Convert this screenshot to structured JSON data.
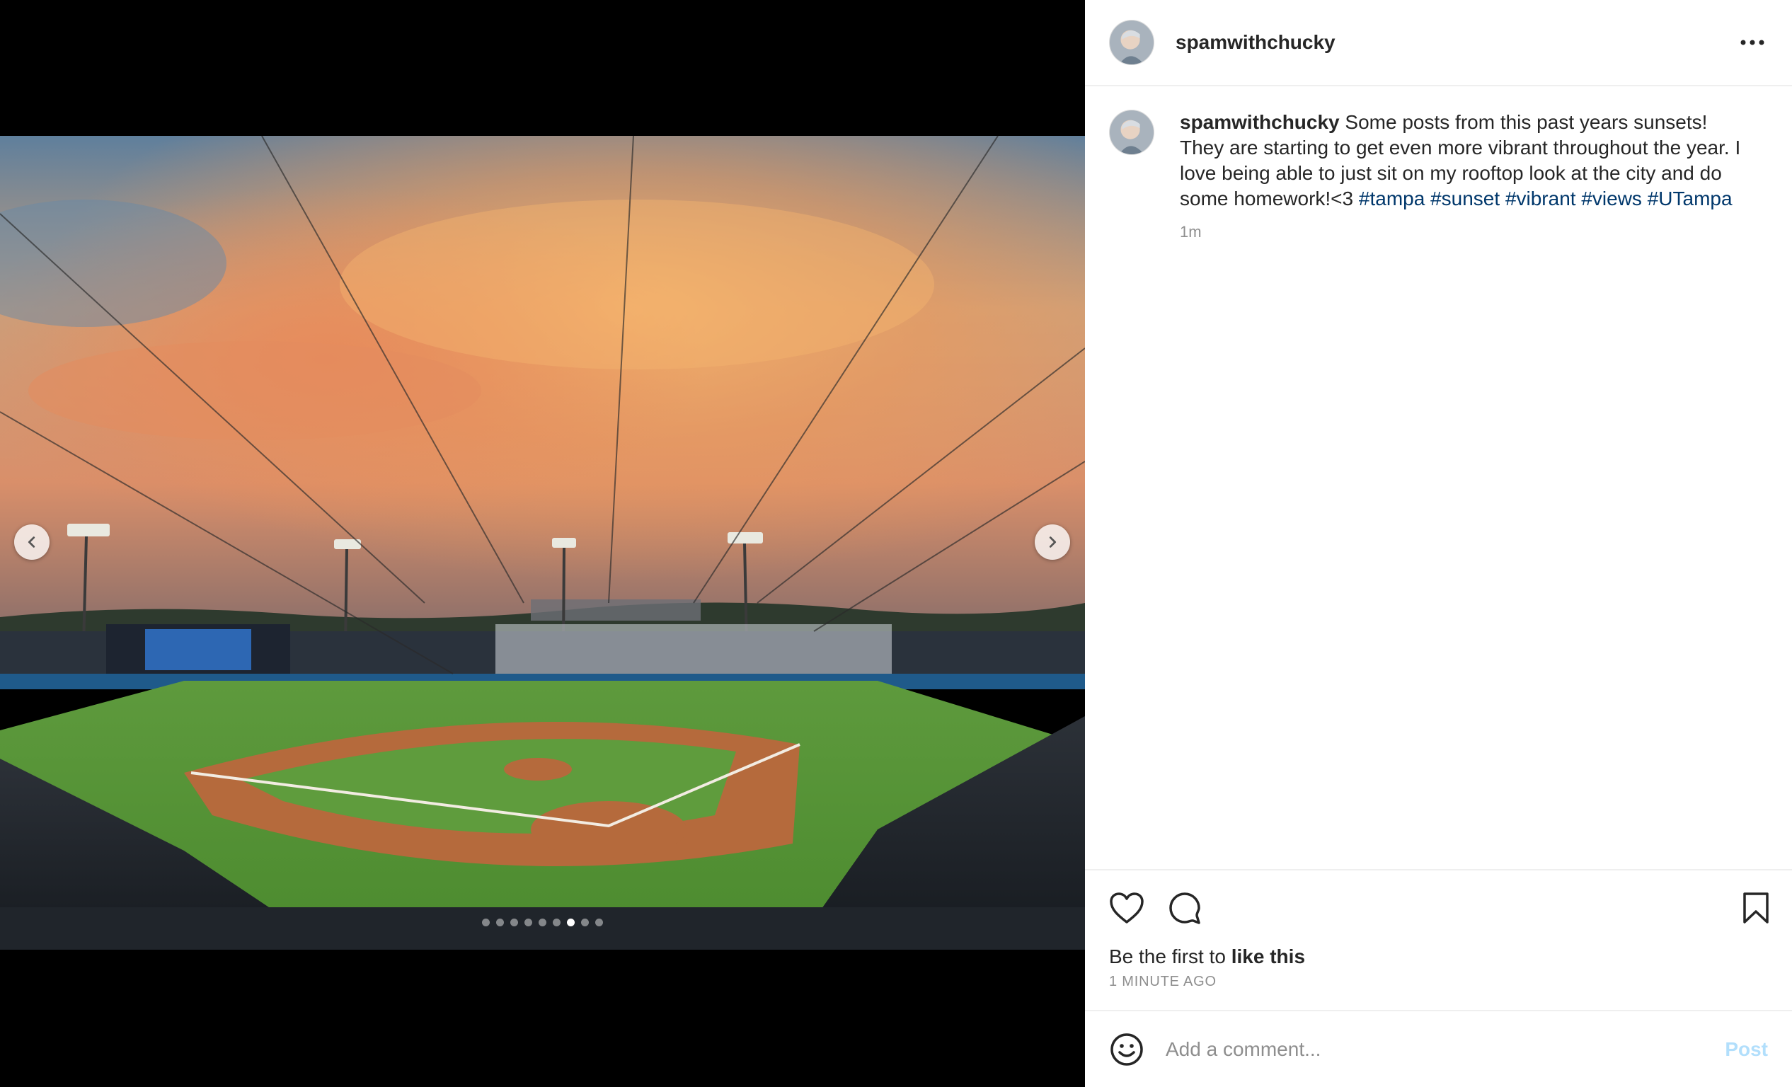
{
  "post": {
    "username": "spamwithchucky",
    "caption_user": "spamwithchucky",
    "caption_text": "Some posts from this past years sunsets! They are starting to get even more vibrant throughout the year. I love being able to just sit on my rooftop look at the city and do some homework!<3",
    "hashtags": [
      "#tampa",
      "#sunset",
      "#vibrant",
      "#views",
      "#UTampa"
    ],
    "caption_time": "1m",
    "likes_prefix": "Be the first to ",
    "likes_link": "like this",
    "post_time": "1 MINUTE AGO"
  },
  "carousel": {
    "slide_count": 9,
    "active_index": 6
  },
  "comment": {
    "placeholder": "Add a comment...",
    "post_label": "Post"
  },
  "icons": {
    "header_more": "more-horizontal-icon",
    "prev": "chevron-left-icon",
    "next": "chevron-right-icon",
    "like": "heart-icon",
    "comment": "comment-bubble-icon",
    "save": "bookmark-icon",
    "emoji": "smiley-icon"
  },
  "colors": {
    "hashtag": "#00376b",
    "post_button_disabled": "#b2dffc",
    "muted_text": "#8e8e8e"
  }
}
